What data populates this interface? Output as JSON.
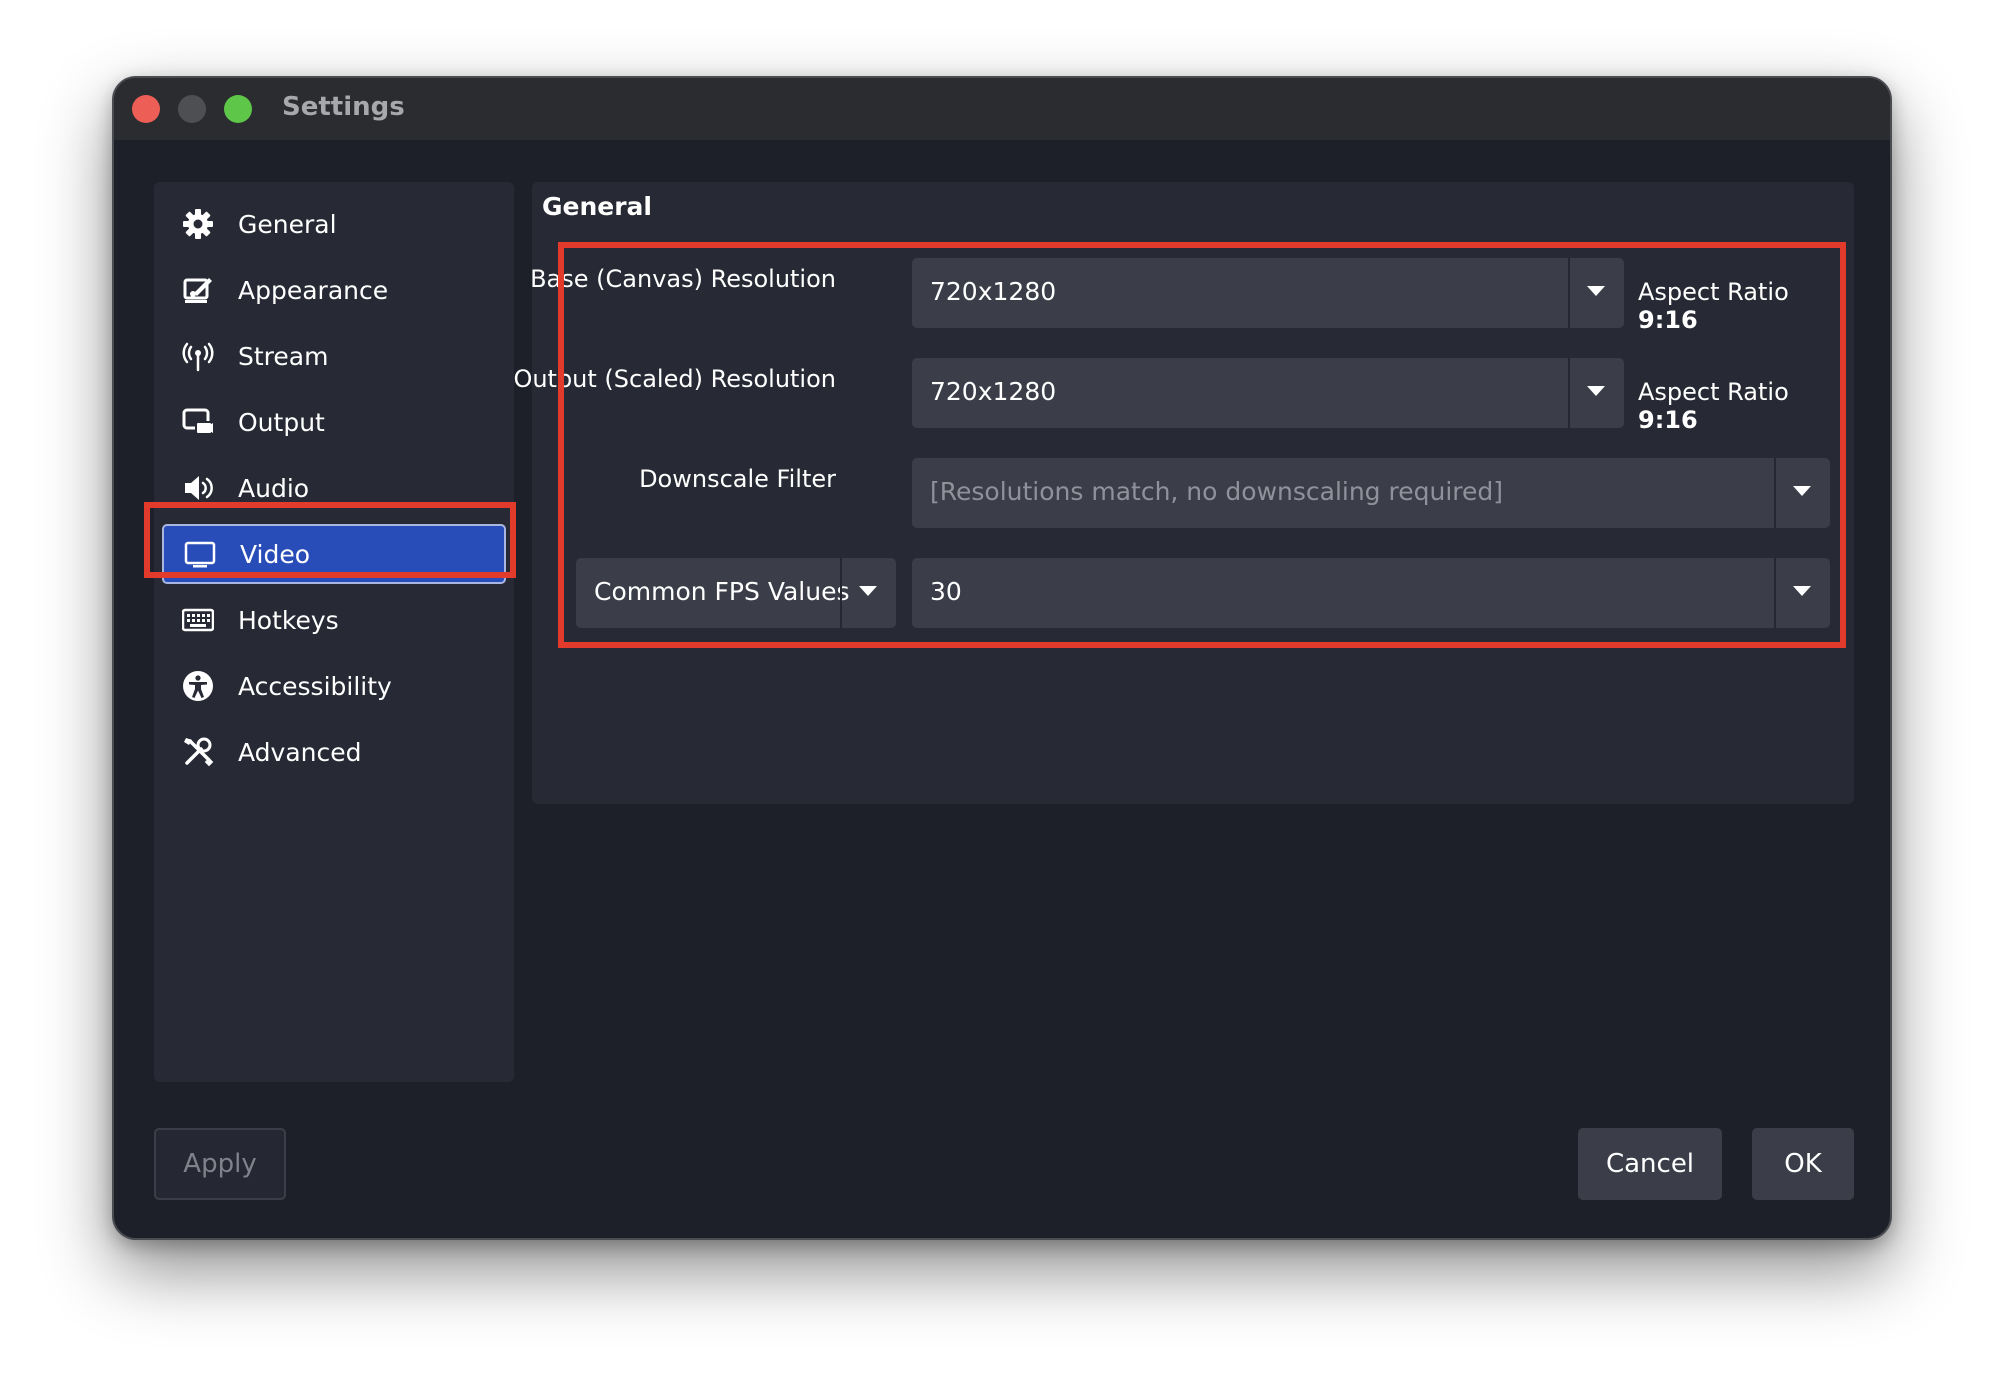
{
  "window": {
    "title": "Settings"
  },
  "sidebar": {
    "items": [
      {
        "label": "General",
        "icon": "gear-icon"
      },
      {
        "label": "Appearance",
        "icon": "appearance-icon"
      },
      {
        "label": "Stream",
        "icon": "antenna-icon"
      },
      {
        "label": "Output",
        "icon": "output-icon"
      },
      {
        "label": "Audio",
        "icon": "speaker-icon"
      },
      {
        "label": "Video",
        "icon": "monitor-icon",
        "selected": true
      },
      {
        "label": "Hotkeys",
        "icon": "keyboard-icon"
      },
      {
        "label": "Accessibility",
        "icon": "accessibility-icon"
      },
      {
        "label": "Advanced",
        "icon": "tools-icon"
      }
    ]
  },
  "panel": {
    "title": "General",
    "base_resolution": {
      "label": "Base (Canvas) Resolution",
      "value": "720x1280",
      "aspect_prefix": "Aspect Ratio",
      "aspect_value": "9:16"
    },
    "output_resolution": {
      "label": "Output (Scaled) Resolution",
      "value": "720x1280",
      "aspect_prefix": "Aspect Ratio",
      "aspect_value": "9:16"
    },
    "downscale_filter": {
      "label": "Downscale Filter",
      "value": "[Resolutions match, no downscaling required]"
    },
    "fps": {
      "type_label": "Common FPS Values",
      "value": "30"
    }
  },
  "buttons": {
    "apply": "Apply",
    "cancel": "Cancel",
    "ok": "OK"
  },
  "colors": {
    "selected": "#284cb8",
    "highlight": "#e23a2b",
    "background": "#1e2029",
    "panel": "#272a34"
  }
}
